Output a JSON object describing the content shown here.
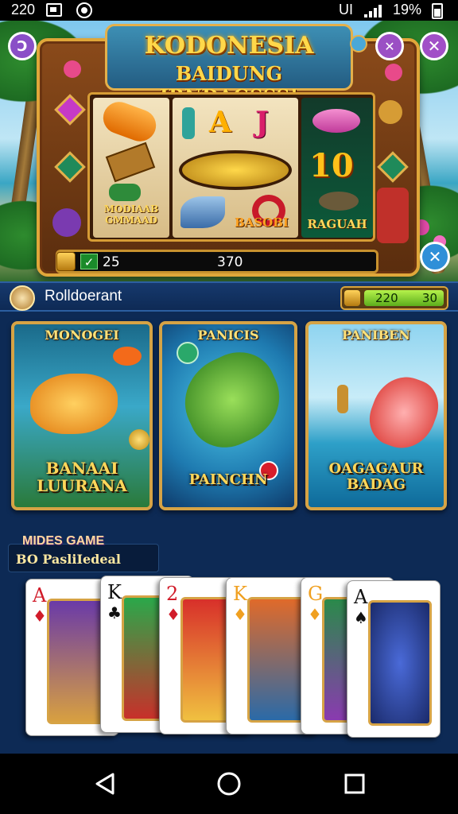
{
  "status_bar": {
    "time": "220",
    "signal_label": "UI",
    "battery": "19%"
  },
  "slot": {
    "title": "KODONESIA",
    "subtitle": "BAIDUNG IRNDAGSSS!",
    "reel1_label": "MODIAAB GMMAAD",
    "reel2_label": "BASOBI",
    "reel3_number": "10",
    "reel3_label": "RAGUAH",
    "bet_value": "25",
    "win_value": "370"
  },
  "info_bar": {
    "title": "Rolldoerant",
    "score_a": "220",
    "score_b": "30"
  },
  "tiles": [
    {
      "title": "MONOGEI",
      "label": "BANAAI LUURANA"
    },
    {
      "title": "PANICIS",
      "label": "PAINCHN"
    },
    {
      "title": "PANIBEN",
      "label": "OAGAGAUR BADAG"
    }
  ],
  "mini_games": {
    "title": "MIDES GAME",
    "subtitle": "BO PasliIedeal"
  },
  "cards": [
    {
      "rank": "A",
      "suit": "♦",
      "color": "#d11c2a"
    },
    {
      "rank": "K",
      "suit": "♣",
      "color": "#111111"
    },
    {
      "rank": "2",
      "suit": "♦",
      "color": "#d11c2a"
    },
    {
      "rank": "K",
      "suit": "♦",
      "color": "#f0a020"
    },
    {
      "rank": "G",
      "suit": "♦",
      "color": "#f0a020"
    },
    {
      "rank": "A",
      "suit": "♠",
      "color": "#111111"
    }
  ],
  "colors": {
    "accent_gold": "#e0a73a",
    "panel_blue": "#0e2a55",
    "close_purple": "#9b4fc4"
  }
}
